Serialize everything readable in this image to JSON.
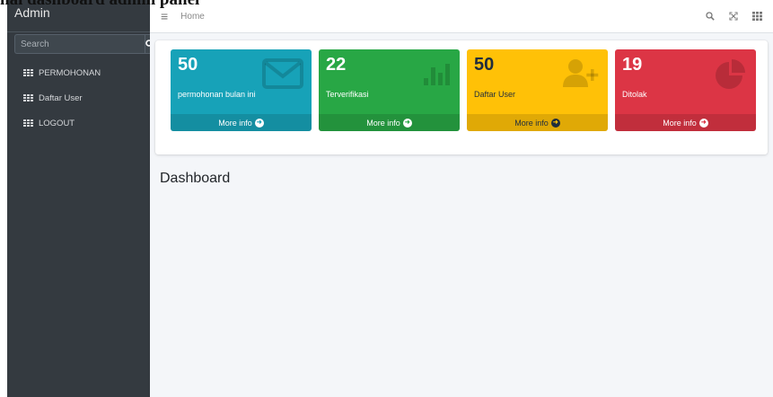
{
  "caption": "hal dashboard admin panel",
  "sidebar": {
    "brand": "Admin",
    "search_placeholder": "Search",
    "items": [
      {
        "label": "PERMOHONAN"
      },
      {
        "label": "Daftar User"
      },
      {
        "label": "LOGOUT"
      }
    ]
  },
  "topbar": {
    "home": "Home"
  },
  "stats": [
    {
      "value": "50",
      "label": "permohonan bulan ini",
      "link": "More info",
      "color": "#17a2b8",
      "icon": "envelope-icon"
    },
    {
      "value": "22",
      "label": "Terverifikasi",
      "link": "More info",
      "color": "#28a745",
      "icon": "bar-chart-icon"
    },
    {
      "value": "50",
      "label": "Daftar User",
      "link": "More info",
      "color": "#ffc107",
      "icon": "user-plus-icon"
    },
    {
      "value": "19",
      "label": "Ditolak",
      "link": "More info",
      "color": "#dc3545",
      "icon": "pie-chart-icon"
    }
  ],
  "dashboard": {
    "title": "Dashboard"
  }
}
